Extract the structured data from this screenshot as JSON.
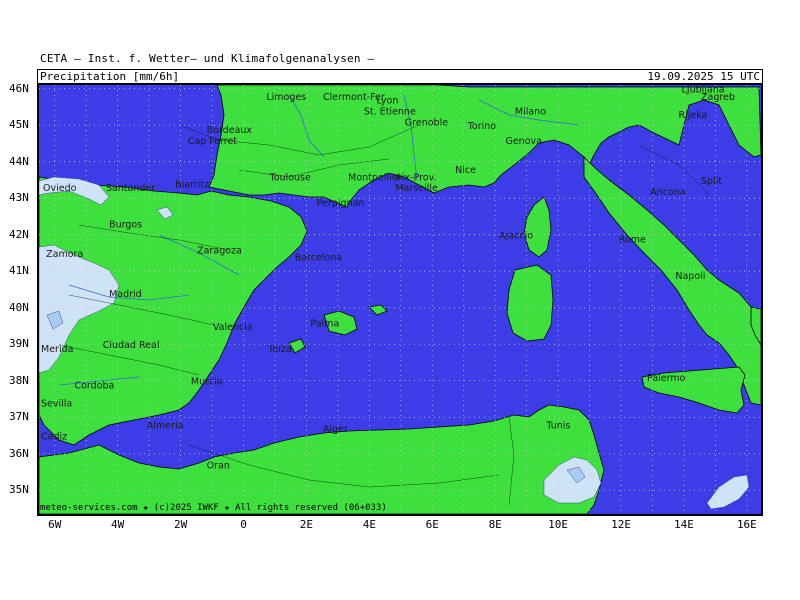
{
  "header": {
    "org": "CETA — Inst. f. Wetter— und Klimafolgenanalysen —",
    "variable": "Precipitation [mm/6h]",
    "valid_time": "19.09.2025  15 UTC"
  },
  "footer": "meteo-services.com ★ (c)2025 IWKF ★ All rights reserved (06+033)",
  "colors": {
    "sea": "#3d3de8",
    "land": "#3ee03e",
    "precip_light": "#cfe3f7",
    "precip_mid": "#a8cdf3",
    "border": "#000000",
    "river": "#3a66d0",
    "grid": "#c8c8c8"
  },
  "lat_labels": [
    "46N",
    "45N",
    "44N",
    "43N",
    "42N",
    "41N",
    "40N",
    "39N",
    "38N",
    "37N",
    "36N",
    "35N"
  ],
  "lon_labels": [
    "6W",
    "4W",
    "2W",
    "0",
    "2E",
    "4E",
    "6E",
    "8E",
    "10E",
    "12E",
    "14E",
    "16E"
  ],
  "cities": [
    {
      "name": "Clermont-Fer.",
      "lon": 3.1,
      "lat": 45.8
    },
    {
      "name": "Ljubljana",
      "lon": 14.5,
      "lat": 46.0
    },
    {
      "name": "Zagreb",
      "lon": 16.0,
      "lat": 45.8
    },
    {
      "name": "Limoges",
      "lon": 1.3,
      "lat": 45.8
    },
    {
      "name": "Lyon",
      "lon": 4.8,
      "lat": 45.7
    },
    {
      "name": "St. Etienne",
      "lon": 4.4,
      "lat": 45.4
    },
    {
      "name": "Milano",
      "lon": 9.2,
      "lat": 45.4
    },
    {
      "name": "Grenoble",
      "lon": 5.7,
      "lat": 45.1
    },
    {
      "name": "Bordeaux",
      "lon": -0.6,
      "lat": 44.9
    },
    {
      "name": "Torino",
      "lon": 7.7,
      "lat": 45.0
    },
    {
      "name": "Genova",
      "lon": 8.9,
      "lat": 44.6
    },
    {
      "name": "Rijeka",
      "lon": 14.4,
      "lat": 45.3
    },
    {
      "name": "Cap Ferret",
      "lon": -1.2,
      "lat": 44.6
    },
    {
      "name": "Nice",
      "lon": 7.3,
      "lat": 43.8
    },
    {
      "name": "Montpellier",
      "lon": 3.9,
      "lat": 43.6
    },
    {
      "name": "Toulouse",
      "lon": 1.4,
      "lat": 43.6
    },
    {
      "name": "Aix-Prov.",
      "lon": 5.4,
      "lat": 43.6
    },
    {
      "name": "Split",
      "lon": 16.4,
      "lat": 43.5
    },
    {
      "name": "Marseille",
      "lon": 5.4,
      "lat": 43.3
    },
    {
      "name": "Ancona",
      "lon": 13.5,
      "lat": 43.2
    },
    {
      "name": "Oviedo",
      "lon": -5.8,
      "lat": 43.3
    },
    {
      "name": "Santander",
      "lon": -3.8,
      "lat": 43.3
    },
    {
      "name": "Biarritz",
      "lon": -1.6,
      "lat": 43.4
    },
    {
      "name": "Perpignan",
      "lon": 2.9,
      "lat": 42.9
    },
    {
      "name": "Burgos",
      "lon": -3.7,
      "lat": 42.3
    },
    {
      "name": "Ajaccio",
      "lon": 8.7,
      "lat": 42.0
    },
    {
      "name": "Rome",
      "lon": 12.5,
      "lat": 41.9
    },
    {
      "name": "Barcelona",
      "lon": 2.2,
      "lat": 41.4
    },
    {
      "name": "Zaragoza",
      "lon": -0.9,
      "lat": 41.6
    },
    {
      "name": "Zamora",
      "lon": -5.7,
      "lat": 41.5
    },
    {
      "name": "Napoli",
      "lon": 14.3,
      "lat": 40.9
    },
    {
      "name": "Madrid",
      "lon": -3.7,
      "lat": 40.4
    },
    {
      "name": "Palma",
      "lon": 2.7,
      "lat": 39.6
    },
    {
      "name": "Valencia",
      "lon": -0.4,
      "lat": 39.5
    },
    {
      "name": "Ibiza",
      "lon": 1.4,
      "lat": 38.9
    },
    {
      "name": "Merida",
      "lon": -6.3,
      "lat": 38.9
    },
    {
      "name": "Ciudad Real",
      "lon": -3.9,
      "lat": 39.0
    },
    {
      "name": "Murcia",
      "lon": -1.1,
      "lat": 38.0
    },
    {
      "name": "Cordoba",
      "lon": -4.8,
      "lat": 37.9
    },
    {
      "name": "Palermo",
      "lon": 13.4,
      "lat": 38.1
    },
    {
      "name": "Sevilla",
      "lon": -6.0,
      "lat": 37.4
    },
    {
      "name": "Almeria",
      "lon": -2.5,
      "lat": 36.8
    },
    {
      "name": "Cadiz",
      "lon": -6.3,
      "lat": 36.5
    },
    {
      "name": "Tunis",
      "lon": 10.2,
      "lat": 36.8
    },
    {
      "name": "Alger",
      "lon": 3.1,
      "lat": 36.7
    },
    {
      "name": "Oran",
      "lon": -0.6,
      "lat": 35.7
    }
  ]
}
